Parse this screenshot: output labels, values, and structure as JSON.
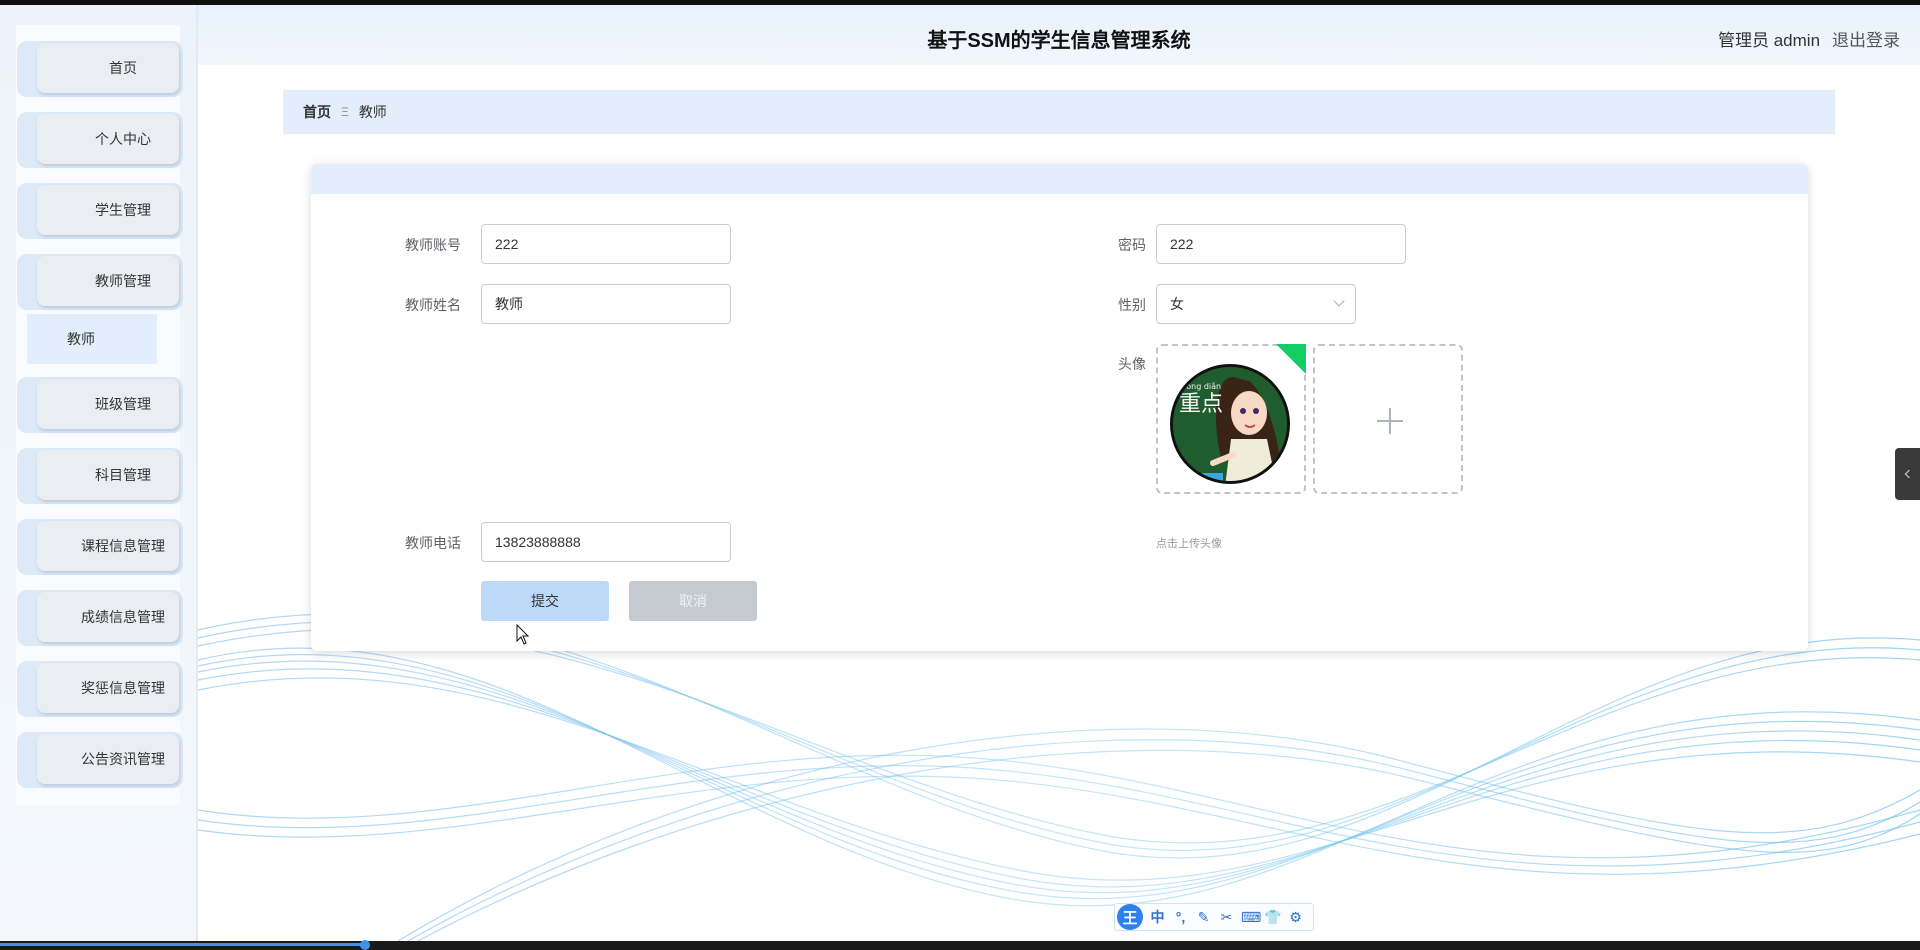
{
  "header": {
    "title": "基于SSM的学生信息管理系统",
    "user": "管理员 admin",
    "logout": "退出登录"
  },
  "sidebar": {
    "items": [
      {
        "label": "首页"
      },
      {
        "label": "个人中心"
      },
      {
        "label": "学生管理"
      },
      {
        "label": "教师管理"
      },
      {
        "label": "班级管理"
      },
      {
        "label": "科目管理"
      },
      {
        "label": "课程信息管理"
      },
      {
        "label": "成绩信息管理"
      },
      {
        "label": "奖惩信息管理"
      },
      {
        "label": "公告资讯管理"
      }
    ],
    "submenu": {
      "label": "教师"
    }
  },
  "breadcrumb": {
    "home": "首页",
    "separator": "Ξ",
    "current": "教师"
  },
  "form": {
    "account": {
      "label": "教师账号",
      "value": "222"
    },
    "password": {
      "label": "密码",
      "value": "222"
    },
    "name": {
      "label": "教师姓名",
      "value": "教师"
    },
    "gender": {
      "label": "性别",
      "value": "女"
    },
    "avatar": {
      "label": "头像",
      "hint": "点击上传头像"
    },
    "phone": {
      "label": "教师电话",
      "value": "13823888888"
    },
    "submit": "提交",
    "cancel": "取消"
  },
  "avatar_image": {
    "text": "重点",
    "pinyin": "zhòng diǎn"
  },
  "ime_toolbar": {
    "logo": "王",
    "items": [
      "中",
      "°,",
      "✎",
      "✂",
      "⌨",
      "👕",
      "⚙"
    ]
  },
  "colors": {
    "accent": "#e2eefb",
    "submit_button": "#bcdaf7",
    "cancel_button": "#c5cad1",
    "upload_success": "#13ce66"
  }
}
